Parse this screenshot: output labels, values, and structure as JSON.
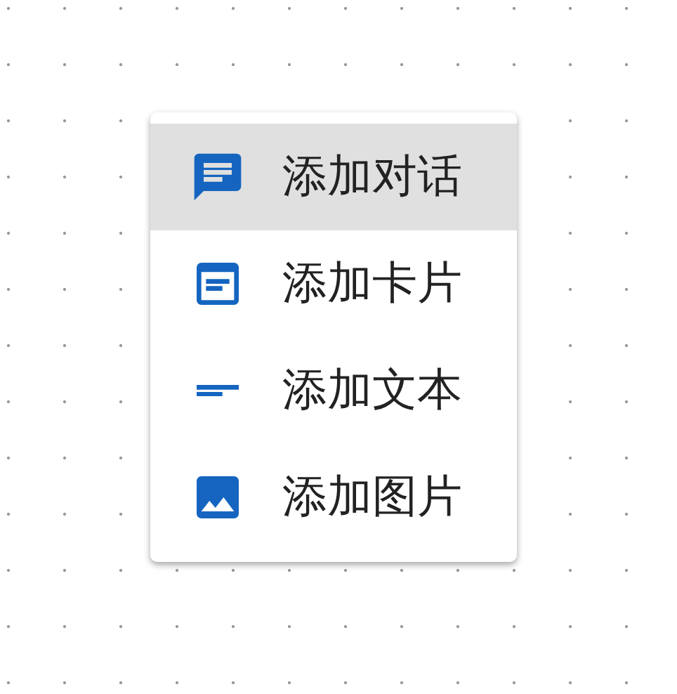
{
  "menu": {
    "items": [
      {
        "kind": "chat",
        "label": "添加对话",
        "selected": true
      },
      {
        "kind": "card",
        "label": "添加卡片",
        "selected": false
      },
      {
        "kind": "text",
        "label": "添加文本",
        "selected": false
      },
      {
        "kind": "image",
        "label": "添加图片",
        "selected": false
      }
    ]
  }
}
